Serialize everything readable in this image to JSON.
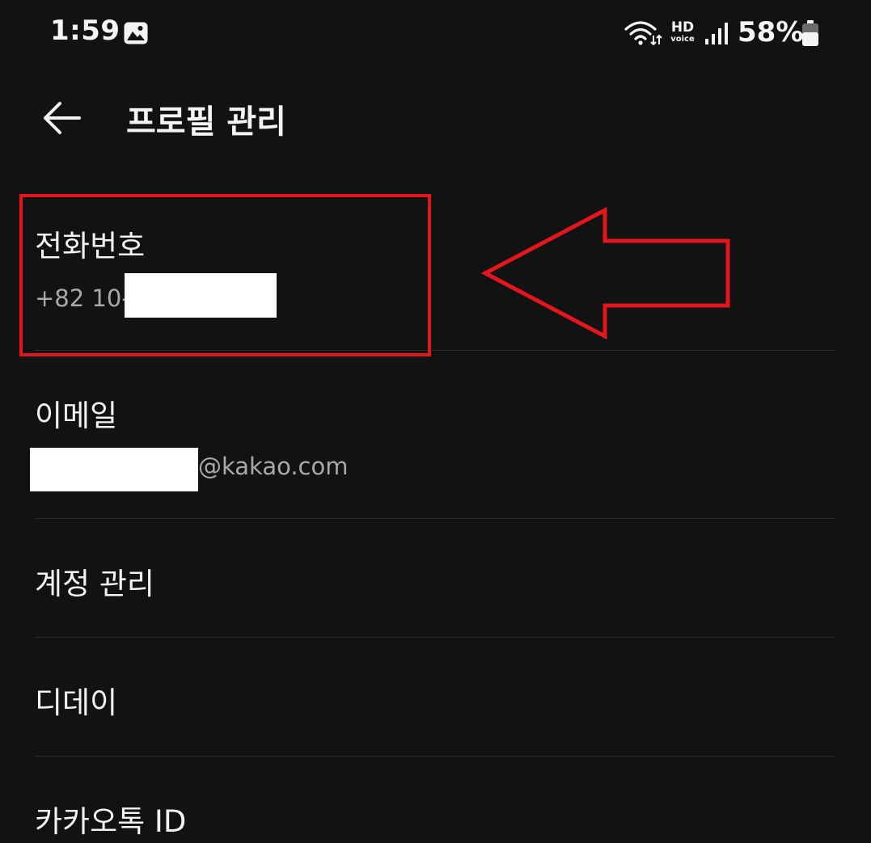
{
  "status_bar": {
    "time": "1:59",
    "hd_label": "HD",
    "voice_label": "voice",
    "battery_percent": "58%",
    "icons": [
      "gallery-icon",
      "wifi-icon",
      "hd-voice-icon",
      "signal-icon",
      "battery-icon"
    ]
  },
  "header": {
    "title": "프로필 관리",
    "back_icon": "arrow-left-icon"
  },
  "items": {
    "phone": {
      "label": "전화번호",
      "value_prefix": "+82 10-"
    },
    "email": {
      "label": "이메일",
      "value_suffix": "@kakao.com"
    },
    "account": {
      "label": "계정 관리"
    },
    "dday": {
      "label": "디데이"
    },
    "kakao_id": {
      "label": "카카오톡 ID"
    }
  },
  "colors": {
    "background": "#121212",
    "annotation_red": "#e3151d",
    "divider": "#2c2c2c",
    "secondary_text": "#a9a9a9"
  }
}
